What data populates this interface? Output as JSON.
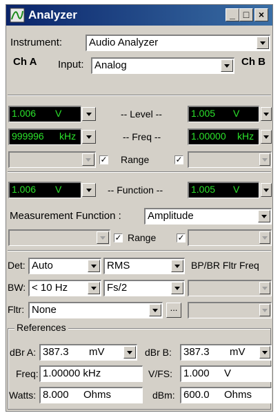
{
  "window": {
    "title": "Analyzer",
    "minimize": "_",
    "maximize": "□",
    "close": "×"
  },
  "instrument": {
    "label": "Instrument:",
    "value": "Audio Analyzer"
  },
  "channels": {
    "a_label": "Ch A",
    "b_label": "Ch B"
  },
  "input": {
    "label": "Input:",
    "value": "Analog"
  },
  "level": {
    "label": "-- Level --",
    "a": {
      "value": "1.006",
      "unit": "V"
    },
    "b": {
      "value": "1.005",
      "unit": "V"
    }
  },
  "freq": {
    "label": "-- Freq --",
    "a": {
      "value": "999996",
      "unit": "kHz"
    },
    "b": {
      "value": "1.00000",
      "unit": "kHz"
    }
  },
  "range1": {
    "label": "Range",
    "checked_a": true,
    "checked_b": true
  },
  "function": {
    "label": "-- Function --",
    "a": {
      "value": "1.006",
      "unit": "V"
    },
    "b": {
      "value": "1.005",
      "unit": "V"
    }
  },
  "measurement_function": {
    "label": "Measurement Function :",
    "value": "Amplitude"
  },
  "range2": {
    "label": "Range",
    "checked_a": true,
    "checked_b": true
  },
  "det": {
    "label": "Det:",
    "value": "Auto",
    "mode": "RMS"
  },
  "bpbr": {
    "label": "BP/BR Fltr Freq"
  },
  "bw": {
    "label": "BW:",
    "value": "< 10 Hz",
    "high": "Fs/2"
  },
  "fltr": {
    "label": "Fltr:",
    "value": "None",
    "more": "..."
  },
  "references": {
    "title": "References",
    "dbra": {
      "label": "dBr A:",
      "value": "387.3",
      "unit": "mV"
    },
    "dbrb": {
      "label": "dBr B:",
      "value": "387.3",
      "unit": "mV"
    },
    "freq": {
      "label": "Freq:",
      "value": "1.00000 kHz"
    },
    "vfs": {
      "label": "V/FS:",
      "value": "1.000",
      "unit": "V"
    },
    "watts": {
      "label": "Watts:",
      "value": "8.000",
      "unit": "Ohms"
    },
    "dbm": {
      "label": "dBm:",
      "value": "600.0",
      "unit": "Ohms"
    }
  },
  "colors": {
    "lcd_bg": "#000000",
    "lcd_text": "#2be32b",
    "titlebar": "#0a246a"
  }
}
